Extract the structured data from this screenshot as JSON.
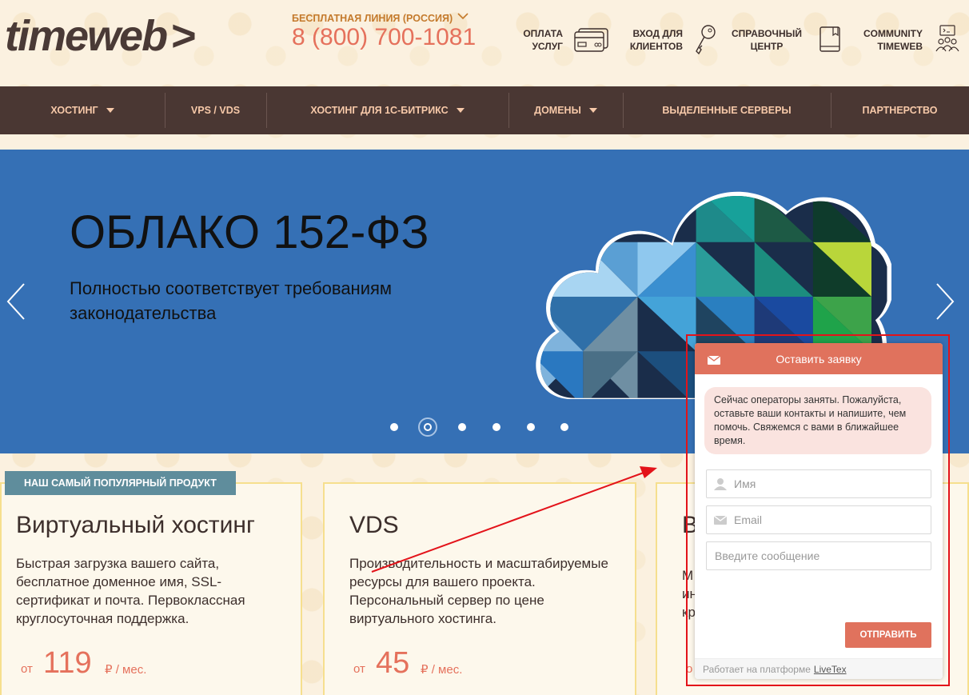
{
  "header": {
    "logo": "timeweb",
    "logo_chevron": ">",
    "hotline_label": "БЕСПЛАТНАЯ ЛИНИЯ (РОССИЯ)",
    "phone": "8 (800) 700-1081",
    "links": [
      {
        "line1": "ОПЛАТА",
        "line2": "УСЛУГ",
        "icon": "credit-card-icon"
      },
      {
        "line1": "ВХОД ДЛЯ",
        "line2": "КЛИЕНТОВ",
        "icon": "key-icon"
      },
      {
        "line1": "СПРАВОЧНЫЙ",
        "line2": "ЦЕНТР",
        "icon": "book-icon"
      },
      {
        "line1": "COMMUNITY",
        "line2": "TIMEWEB",
        "icon": "community-icon"
      }
    ]
  },
  "nav": {
    "items": [
      {
        "label": "ХОСТИНГ",
        "dropdown": true
      },
      {
        "label": "VPS / VDS",
        "dropdown": false
      },
      {
        "label": "ХОСТИНГ ДЛЯ 1С-БИТРИКС",
        "dropdown": true
      },
      {
        "label": "ДОМЕНЫ",
        "dropdown": true
      },
      {
        "label": "ВЫДЕЛЕННЫЕ СЕРВЕРЫ",
        "dropdown": false
      },
      {
        "label": "ПАРТНЕРСТВО",
        "dropdown": false
      }
    ]
  },
  "banner": {
    "title": "ОБЛАКО 152-ФЗ",
    "subtitle": "Полностью соответствует требованиям законодательства",
    "slide_count": 6,
    "active_slide": 2,
    "bg_color": "#3570b5"
  },
  "cards": {
    "badge": "НАШ САМЫЙ ПОПУЛЯРНЫЙ ПРОДУКТ",
    "items": [
      {
        "title": "Виртуальный хостинг",
        "desc": "Быстрая загрузка вашего сайта, бесплатное доменное имя, SSL-сертификат и почта. Первоклассная круглосуточная поддержка.",
        "price_from": "от",
        "price": "119",
        "price_unit": "₽ / мес."
      },
      {
        "title": "VDS",
        "desc": "Производительность и масштабируемые ресурсы для вашего проекта. Персональный сервер по цене виртуального хостинга.",
        "price_from": "от",
        "price": "45",
        "price_unit": "₽ / мес."
      },
      {
        "title": "В",
        "desc": "М\nин\nкр",
        "price_from": "о",
        "price": "",
        "price_unit": ""
      }
    ]
  },
  "chat": {
    "title": "Оставить заявку",
    "message": "Сейчас операторы заняты. Пожалуйста, оставьте ваши контакты и напишите, чем помочь. Свяжемся с вами в ближайшее время.",
    "name_placeholder": "Имя",
    "email_placeholder": "Email",
    "message_placeholder": "Введите сообщение",
    "send_label": "ОТПРАВИТЬ",
    "footer_text": "Работает на платформе",
    "footer_link": "LiveTex",
    "accent_color": "#e0725d"
  }
}
